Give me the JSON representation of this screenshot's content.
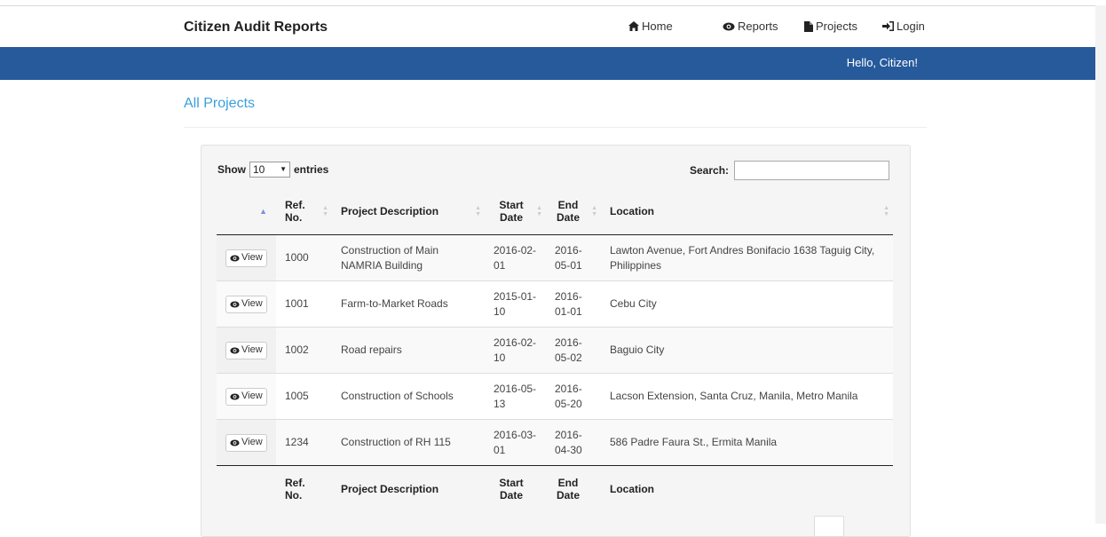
{
  "header": {
    "brand": "Citizen Audit Reports",
    "nav": [
      {
        "label": "Home",
        "icon": "home-icon"
      },
      {
        "label": "Reports",
        "icon": "eye-icon"
      },
      {
        "label": "Projects",
        "icon": "file-icon"
      },
      {
        "label": "Login",
        "icon": "login-icon"
      }
    ]
  },
  "banner": {
    "greeting": "Hello, Citizen!"
  },
  "page": {
    "title": "All Projects"
  },
  "table": {
    "length": {
      "prefix": "Show",
      "value": "10",
      "suffix": "entries"
    },
    "search": {
      "label": "Search:",
      "value": ""
    },
    "columns": [
      "",
      "Ref. No.",
      "Project Description",
      "Start Date",
      "End Date",
      "Location"
    ],
    "view_label": "View",
    "rows": [
      {
        "ref": "1000",
        "desc": "Construction of Main NAMRIA Building",
        "start": "2016-02-01",
        "end": "2016-05-01",
        "location": "Lawton Avenue, Fort Andres Bonifacio 1638 Taguig City, Philippines"
      },
      {
        "ref": "1001",
        "desc": "Farm-to-Market Roads",
        "start": "2015-01-10",
        "end": "2016-01-01",
        "location": "Cebu City"
      },
      {
        "ref": "1002",
        "desc": "Road repairs",
        "start": "2016-02-10",
        "end": "2016-05-02",
        "location": "Baguio City"
      },
      {
        "ref": "1005",
        "desc": "Construction of Schools",
        "start": "2016-05-13",
        "end": "2016-05-20",
        "location": "Lacson Extension, Santa Cruz, Manila, Metro Manila"
      },
      {
        "ref": "1234",
        "desc": "Construction of RH 115",
        "start": "2016-03-01",
        "end": "2016-04-30",
        "location": "586 Padre Faura St., Ermita Manila"
      }
    ]
  },
  "colors": {
    "banner": "#265a9a",
    "link": "#3a9fdb"
  }
}
